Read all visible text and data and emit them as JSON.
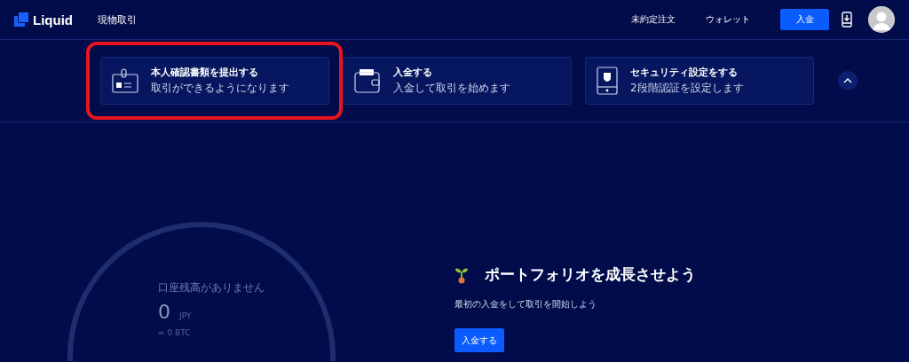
{
  "header": {
    "logo": "Liquid",
    "nav": "現物取引",
    "links": [
      "未約定注文",
      "ウォレット"
    ],
    "deposit_button": "入金"
  },
  "tasks": [
    {
      "kind": "id",
      "title": "本人確認書類を提出する",
      "subtitle": "取引ができるようになります",
      "highlighted": true
    },
    {
      "kind": "wallet",
      "title": "入金する",
      "subtitle": "入金して取引を始めます",
      "highlighted": false
    },
    {
      "kind": "security",
      "title": "セキュリティ設定をする",
      "subtitle": "2段階認証を設定します",
      "highlighted": false
    }
  ],
  "balance": {
    "caption": "口座残高がありません",
    "amount": "0",
    "currency": "JPY",
    "btc": "≈ 0 BTC"
  },
  "promo": {
    "title": "ポートフォリオを成長させよう",
    "text": "最初の入金をして取引を開始しよう",
    "button": "入金する"
  }
}
